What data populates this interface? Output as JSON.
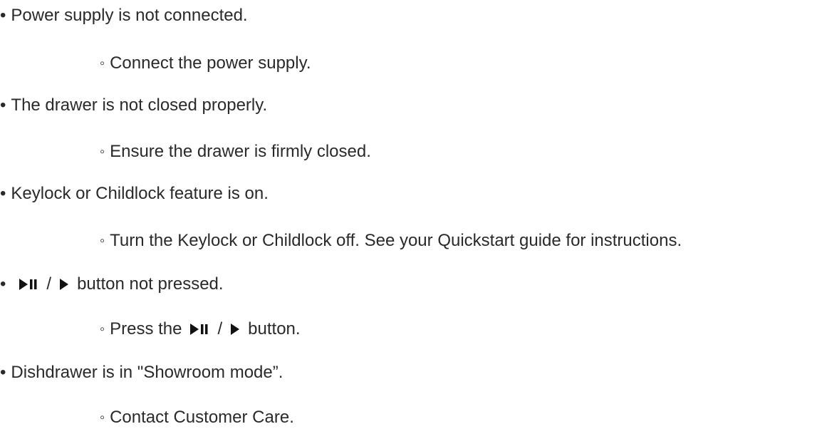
{
  "bullet_marker": "•",
  "sub_marker": "◦",
  "separator": "/",
  "items": [
    {
      "issue": "Power supply is not connected.",
      "remedy": "Connect the power supply."
    },
    {
      "issue": "The drawer is not closed properly.",
      "remedy": "Ensure the drawer is firmly closed."
    },
    {
      "issue": "Keylock or Childlock feature is on.",
      "remedy": "Turn the Keylock or Childlock off. See your Quickstart guide for instructions."
    },
    {
      "issue_icons": [
        "play-pause-icon",
        "play-icon"
      ],
      "issue_suffix": "button not pressed.",
      "remedy_prefix": "Press the",
      "remedy_icons": [
        "play-pause-icon",
        "play-icon"
      ],
      "remedy_suffix": "button."
    },
    {
      "issue": "Dishdrawer is in \"Showroom mode”.",
      "remedy": "Contact Customer Care."
    }
  ]
}
